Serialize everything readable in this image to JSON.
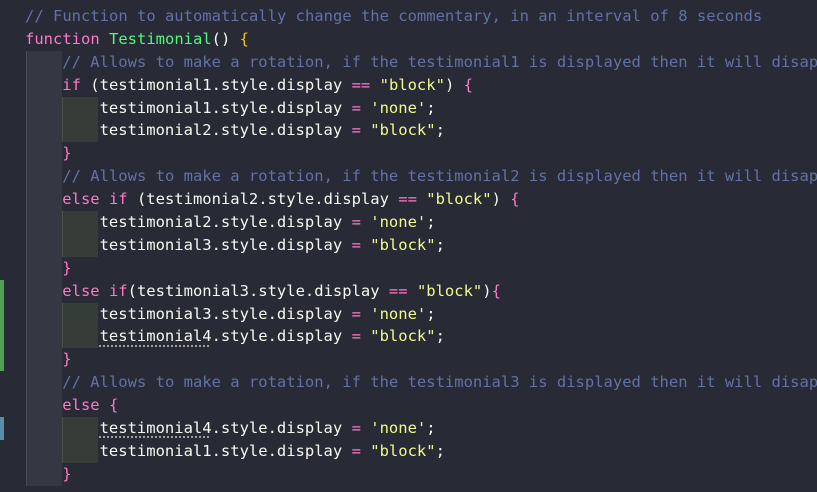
{
  "editor": {
    "lines": [
      {
        "indent": 0,
        "tokens": [
          {
            "t": "// Function to automatically change the commentary, in an interval of 8 seconds",
            "c": "comment"
          }
        ]
      },
      {
        "indent": 0,
        "tokens": [
          {
            "t": "function ",
            "c": "keyword"
          },
          {
            "t": "Testimonial",
            "c": "fn"
          },
          {
            "t": "() ",
            "c": "plain"
          },
          {
            "t": "{",
            "c": "brace-gold"
          }
        ]
      },
      {
        "indent": 1,
        "tokens": [
          {
            "t": "// Allows to make a rotation, if the testimonial1 is displayed then it will disapp",
            "c": "comment"
          }
        ]
      },
      {
        "indent": 1,
        "tokens": [
          {
            "t": "if ",
            "c": "keyword"
          },
          {
            "t": "(testimonial1.style.display ",
            "c": "plain"
          },
          {
            "t": "==",
            "c": "op"
          },
          {
            "t": " ",
            "c": "plain"
          },
          {
            "t": "\"block\"",
            "c": "string"
          },
          {
            "t": ") ",
            "c": "plain"
          },
          {
            "t": "{",
            "c": "brace"
          }
        ]
      },
      {
        "indent": 2,
        "tokens": [
          {
            "t": "testimonial1.style.display ",
            "c": "plain"
          },
          {
            "t": "=",
            "c": "op"
          },
          {
            "t": " ",
            "c": "plain"
          },
          {
            "t": "'none'",
            "c": "string"
          },
          {
            "t": ";",
            "c": "plain"
          }
        ]
      },
      {
        "indent": 2,
        "tokens": [
          {
            "t": "testimonial2.style.display ",
            "c": "plain"
          },
          {
            "t": "=",
            "c": "op"
          },
          {
            "t": " ",
            "c": "plain"
          },
          {
            "t": "\"block\"",
            "c": "string"
          },
          {
            "t": ";",
            "c": "plain"
          }
        ]
      },
      {
        "indent": 1,
        "tokens": [
          {
            "t": "}",
            "c": "brace"
          }
        ]
      },
      {
        "indent": 1,
        "tokens": [
          {
            "t": "// Allows to make a rotation, if the testimonial2 is displayed then it will disapp",
            "c": "comment"
          }
        ]
      },
      {
        "indent": 1,
        "tokens": [
          {
            "t": "else if ",
            "c": "keyword"
          },
          {
            "t": "(testimonial2.style.display ",
            "c": "plain"
          },
          {
            "t": "==",
            "c": "op"
          },
          {
            "t": " ",
            "c": "plain"
          },
          {
            "t": "\"block\"",
            "c": "string"
          },
          {
            "t": ") ",
            "c": "plain"
          },
          {
            "t": "{",
            "c": "brace"
          }
        ]
      },
      {
        "indent": 2,
        "tokens": [
          {
            "t": "testimonial2.style.display ",
            "c": "plain"
          },
          {
            "t": "=",
            "c": "op"
          },
          {
            "t": " ",
            "c": "plain"
          },
          {
            "t": "'none'",
            "c": "string"
          },
          {
            "t": ";",
            "c": "plain"
          }
        ]
      },
      {
        "indent": 2,
        "tokens": [
          {
            "t": "testimonial3.style.display ",
            "c": "plain"
          },
          {
            "t": "=",
            "c": "op"
          },
          {
            "t": " ",
            "c": "plain"
          },
          {
            "t": "\"block\"",
            "c": "string"
          },
          {
            "t": ";",
            "c": "plain"
          }
        ]
      },
      {
        "indent": 1,
        "tokens": [
          {
            "t": "}",
            "c": "brace"
          }
        ]
      },
      {
        "indent": 1,
        "tokens": [
          {
            "t": "else if",
            "c": "keyword"
          },
          {
            "t": "(testimonial3.style.display ",
            "c": "plain"
          },
          {
            "t": "==",
            "c": "op"
          },
          {
            "t": " ",
            "c": "plain"
          },
          {
            "t": "\"block\"",
            "c": "string"
          },
          {
            "t": ")",
            "c": "plain"
          },
          {
            "t": "{",
            "c": "brace"
          }
        ]
      },
      {
        "indent": 2,
        "tokens": [
          {
            "t": "testimonial3.style.display ",
            "c": "plain"
          },
          {
            "t": "=",
            "c": "op"
          },
          {
            "t": " ",
            "c": "plain"
          },
          {
            "t": "'none'",
            "c": "string"
          },
          {
            "t": ";",
            "c": "plain"
          }
        ]
      },
      {
        "indent": 2,
        "tokens": [
          {
            "t": "testimonial4",
            "c": "plain dotted"
          },
          {
            "t": ".style.display ",
            "c": "plain"
          },
          {
            "t": "=",
            "c": "op"
          },
          {
            "t": " ",
            "c": "plain"
          },
          {
            "t": "\"block\"",
            "c": "string"
          },
          {
            "t": ";",
            "c": "plain"
          }
        ]
      },
      {
        "indent": 1,
        "tokens": [
          {
            "t": "}",
            "c": "brace"
          }
        ]
      },
      {
        "indent": 1,
        "tokens": [
          {
            "t": "// Allows to make a rotation, if the testimonial3 is displayed then it will disapp",
            "c": "comment"
          }
        ]
      },
      {
        "indent": 1,
        "tokens": [
          {
            "t": "else ",
            "c": "keyword"
          },
          {
            "t": "{",
            "c": "brace"
          }
        ]
      },
      {
        "indent": 2,
        "tokens": [
          {
            "t": "testimonial4",
            "c": "plain dotted"
          },
          {
            "t": ".style.display ",
            "c": "plain"
          },
          {
            "t": "=",
            "c": "op"
          },
          {
            "t": " ",
            "c": "plain"
          },
          {
            "t": "'none'",
            "c": "string"
          },
          {
            "t": ";",
            "c": "plain"
          }
        ]
      },
      {
        "indent": 2,
        "tokens": [
          {
            "t": "testimonial1.style.display ",
            "c": "plain"
          },
          {
            "t": "=",
            "c": "op"
          },
          {
            "t": " ",
            "c": "plain"
          },
          {
            "t": "\"block\"",
            "c": "string"
          },
          {
            "t": ";",
            "c": "plain"
          }
        ]
      },
      {
        "indent": 1,
        "tokens": [
          {
            "t": "}",
            "c": "brace"
          }
        ]
      }
    ],
    "git_marks": [
      {
        "kind": "added",
        "from_line": 12,
        "to_line": 15
      },
      {
        "kind": "modified",
        "from_line": 18,
        "to_line": 18
      }
    ]
  },
  "theme": {
    "background": "#282a36",
    "comment": "#6272a4",
    "keyword": "#ff79c6",
    "function": "#50fa7b",
    "string": "#f1fa8c",
    "foreground": "#f8f8f2",
    "git_added": "#50a14f",
    "git_modified": "#5b8fa8"
  }
}
